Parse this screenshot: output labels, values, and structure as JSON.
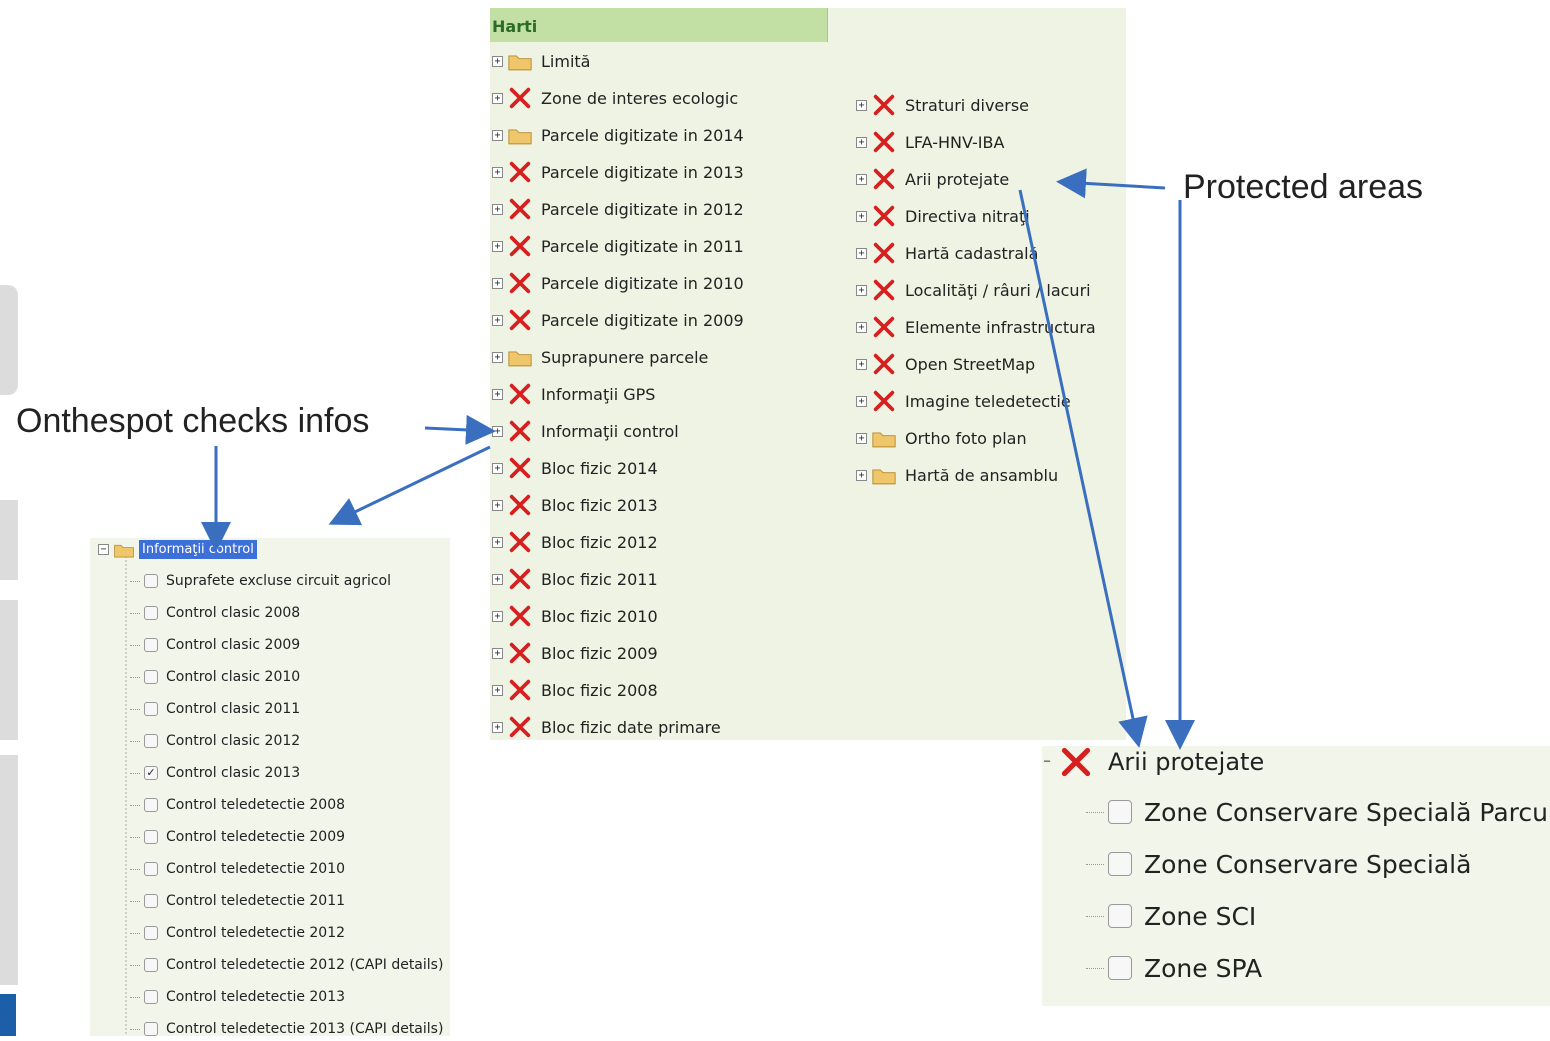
{
  "main_tree": {
    "header": "Harti",
    "left_items": [
      {
        "label": "Limită",
        "icon": "folder-icon"
      },
      {
        "label": "Zone de interes ecologic",
        "icon": "red-x-icon"
      },
      {
        "label": "Parcele digitizate in 2014",
        "icon": "folder-icon"
      },
      {
        "label": "Parcele digitizate in 2013",
        "icon": "red-x-icon"
      },
      {
        "label": "Parcele digitizate in 2012",
        "icon": "red-x-icon"
      },
      {
        "label": "Parcele digitizate in 2011",
        "icon": "red-x-icon"
      },
      {
        "label": "Parcele digitizate in 2010",
        "icon": "red-x-icon"
      },
      {
        "label": "Parcele digitizate in 2009",
        "icon": "red-x-icon"
      },
      {
        "label": "Suprapunere parcele",
        "icon": "folder-icon"
      },
      {
        "label": "Informaţii GPS",
        "icon": "red-x-icon"
      },
      {
        "label": "Informaţii control",
        "icon": "red-x-icon"
      },
      {
        "label": "Bloc fizic 2014",
        "icon": "red-x-icon"
      },
      {
        "label": "Bloc fizic 2013",
        "icon": "red-x-icon"
      },
      {
        "label": "Bloc fizic 2012",
        "icon": "red-x-icon"
      },
      {
        "label": "Bloc fizic 2011",
        "icon": "red-x-icon"
      },
      {
        "label": "Bloc fizic 2010",
        "icon": "red-x-icon"
      },
      {
        "label": "Bloc fizic 2009",
        "icon": "red-x-icon"
      },
      {
        "label": "Bloc fizic 2008",
        "icon": "red-x-icon"
      },
      {
        "label": "Bloc fizic date primare",
        "icon": "red-x-icon"
      }
    ],
    "right_items": [
      {
        "label": "Straturi diverse",
        "icon": "red-x-icon"
      },
      {
        "label": "LFA-HNV-IBA",
        "icon": "red-x-icon"
      },
      {
        "label": "Arii protejate",
        "icon": "red-x-icon"
      },
      {
        "label": "Directiva nitraţi",
        "icon": "red-x-icon"
      },
      {
        "label": "Hartă cadastrală",
        "icon": "red-x-icon"
      },
      {
        "label": "Localităţi / râuri / lacuri",
        "icon": "red-x-icon"
      },
      {
        "label": "Elemente infrastructura",
        "icon": "red-x-icon"
      },
      {
        "label": "Open StreetMap",
        "icon": "red-x-icon"
      },
      {
        "label": "Imagine teledetectie",
        "icon": "red-x-icon"
      },
      {
        "label": "Ortho foto plan",
        "icon": "folder-icon"
      },
      {
        "label": "Hartă de ansamblu",
        "icon": "folder-icon"
      }
    ]
  },
  "control_tree": {
    "title": "Informaţii control",
    "items": [
      {
        "label": "Suprafete excluse circuit agricol",
        "checked": false
      },
      {
        "label": "Control clasic 2008",
        "checked": false
      },
      {
        "label": "Control clasic 2009",
        "checked": false
      },
      {
        "label": "Control clasic 2010",
        "checked": false
      },
      {
        "label": "Control clasic 2011",
        "checked": false
      },
      {
        "label": "Control clasic 2012",
        "checked": false
      },
      {
        "label": "Control clasic 2013",
        "checked": true
      },
      {
        "label": "Control teledetectie 2008",
        "checked": false
      },
      {
        "label": "Control teledetectie 2009",
        "checked": false
      },
      {
        "label": "Control teledetectie 2010",
        "checked": false
      },
      {
        "label": "Control teledetectie 2011",
        "checked": false
      },
      {
        "label": "Control teledetectie 2012",
        "checked": false
      },
      {
        "label": "Control teledetectie 2012 (CAPI details)",
        "checked": false
      },
      {
        "label": "Control teledetectie 2013",
        "checked": false
      },
      {
        "label": "Control teledetectie 2013 (CAPI details)",
        "checked": false
      }
    ]
  },
  "arii_tree": {
    "title": "Arii protejate",
    "items": [
      {
        "label": "Zone Conservare Specială Parcuri",
        "checked": false
      },
      {
        "label": "Zone Conservare Specială",
        "checked": false
      },
      {
        "label": "Zone SCI",
        "checked": false
      },
      {
        "label": "Zone SPA",
        "checked": false
      }
    ]
  },
  "annotations": {
    "onthespot": "Onthespot checks infos",
    "protected": "Protected areas"
  },
  "colors": {
    "panel_bg": "#eef3e3",
    "header_bg": "#c3e0a4",
    "arrow": "#3a6fbf",
    "x_red": "#d62020",
    "folder": "#f0c66a",
    "selection": "#3d6fd8"
  }
}
